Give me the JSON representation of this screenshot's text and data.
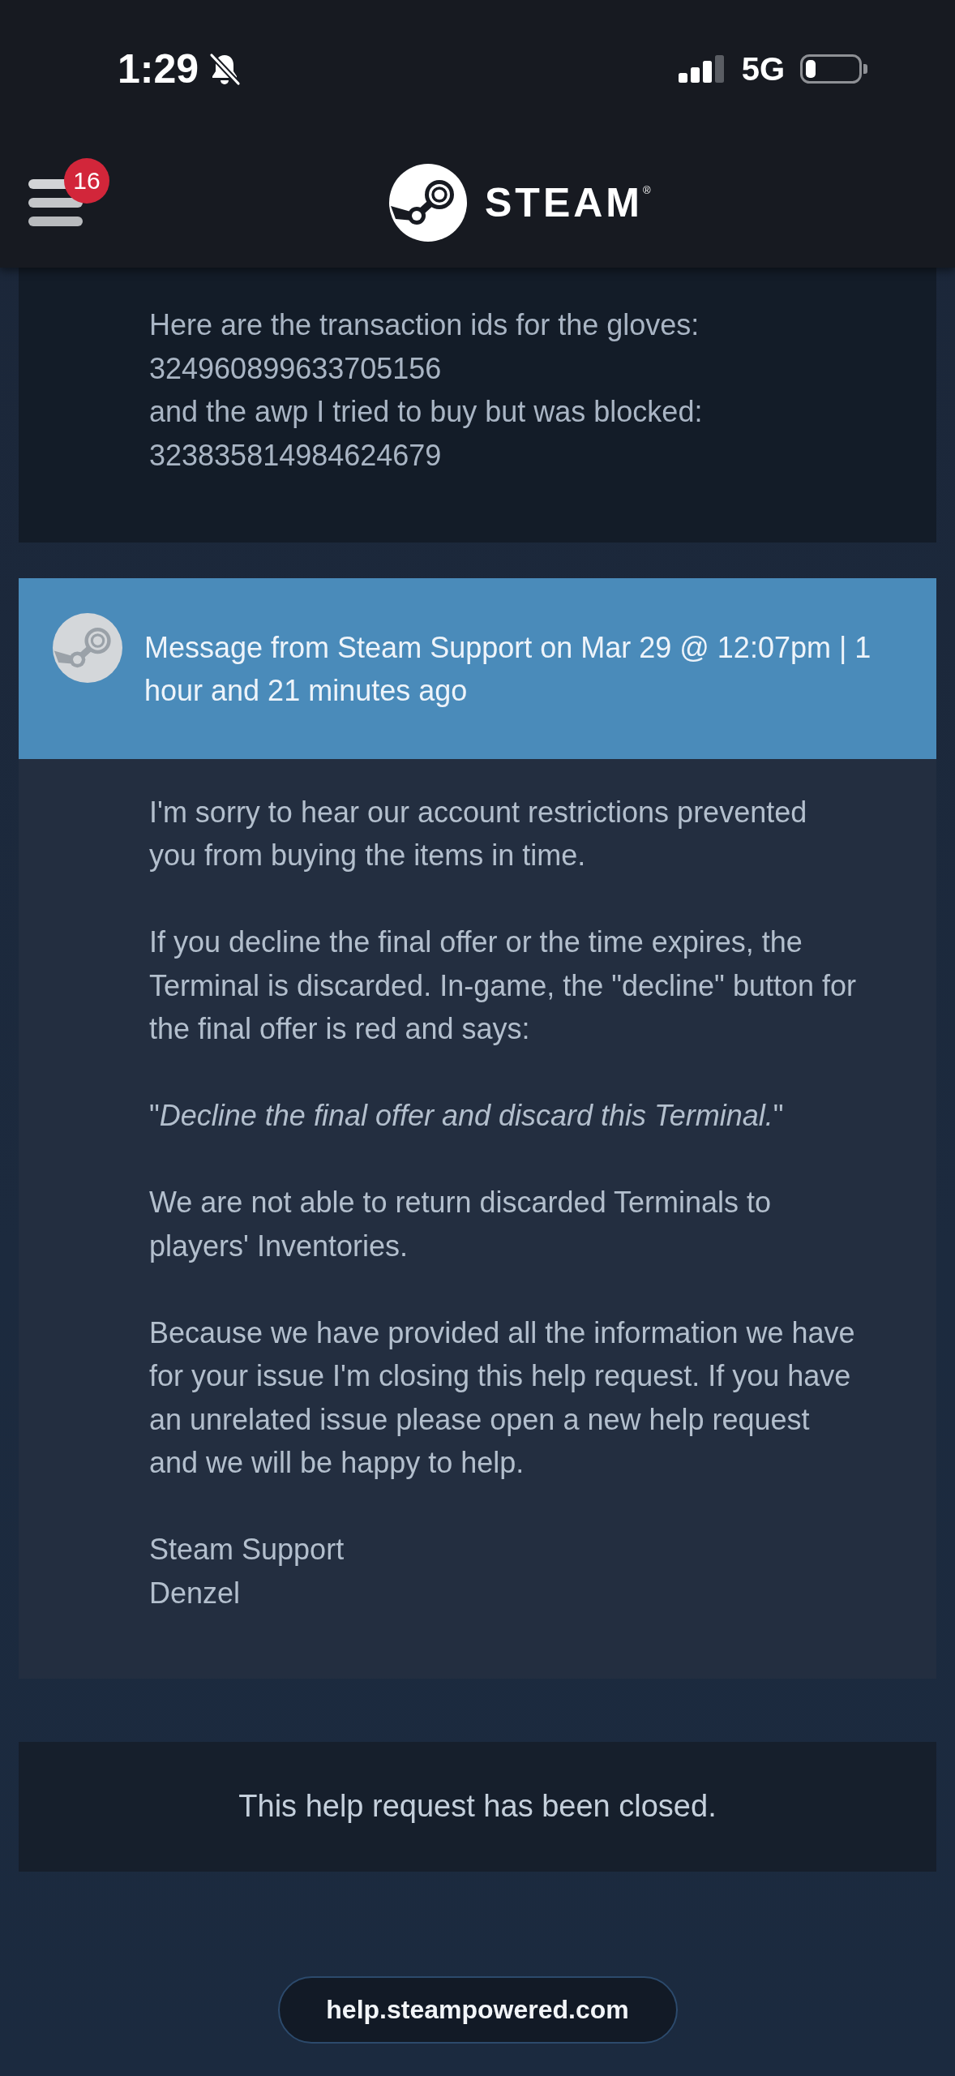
{
  "status_bar": {
    "time": "1:29",
    "network": "5G"
  },
  "header": {
    "menu_badge": "16",
    "logo": "STEAM$^{®}$"
  },
  "messages": [
    {
      "kind": "user",
      "paragraphs": [
        "Here are the transaction ids for the gloves:\n324960899633705156\nand the awp I tried to buy but was blocked:\n323835814984624679"
      ]
    },
    {
      "kind": "support",
      "header": "Message from Steam Support on Mar 29 @ 12:07pm | 1 hour and 21 minutes ago",
      "paragraphs": [
        "I'm sorry to hear our account restrictions prevented you from buying the items in time.",
        "If you decline the final offer or the time expires, the Terminal is discarded. In-game, the \"decline\" button for the final offer is red and says:",
        "\"*Decline the final offer and discard this Terminal.*\"",
        "We are not able to return discarded Terminals to players' Inventories.",
        "Because we have provided all the information we have for your issue I'm closing this help request. If you have an unrelated issue please open a new help request and we will be happy to help.",
        "Steam Support\nDenzel"
      ]
    }
  ],
  "closed_notice": "This help request has been closed.",
  "url_bar": {
    "url": "help.steampowered.com"
  }
}
